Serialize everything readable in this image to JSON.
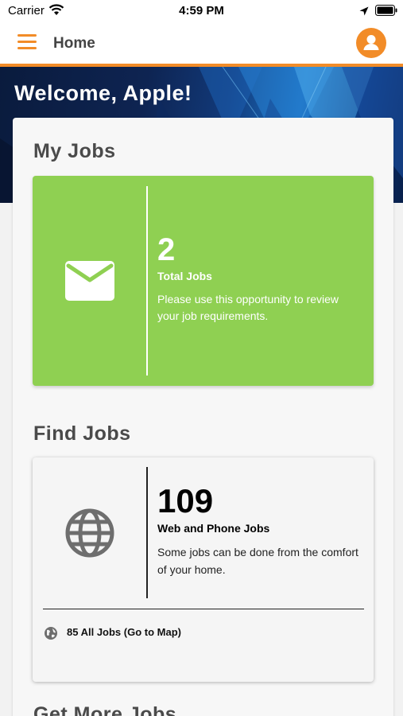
{
  "status_bar": {
    "carrier": "Carrier",
    "time": "4:59 PM"
  },
  "header": {
    "title": "Home",
    "accent_color": "#f28c28"
  },
  "banner": {
    "title": "Welcome, Apple!"
  },
  "my_jobs": {
    "section_title": "My Jobs",
    "count": "2",
    "label": "Total Jobs",
    "description": "Please use this opportunity to review your job requirements.",
    "card_color": "#8fd052",
    "icon": "mail-icon"
  },
  "find_jobs": {
    "section_title": "Find Jobs",
    "count": "109",
    "label": "Web and Phone Jobs",
    "description": "Some jobs can be done from the comfort of your home.",
    "icon": "globe-icon",
    "map_link": "85 All Jobs (Go to Map)"
  },
  "next_section": {
    "section_title": "Get More Jobs"
  }
}
